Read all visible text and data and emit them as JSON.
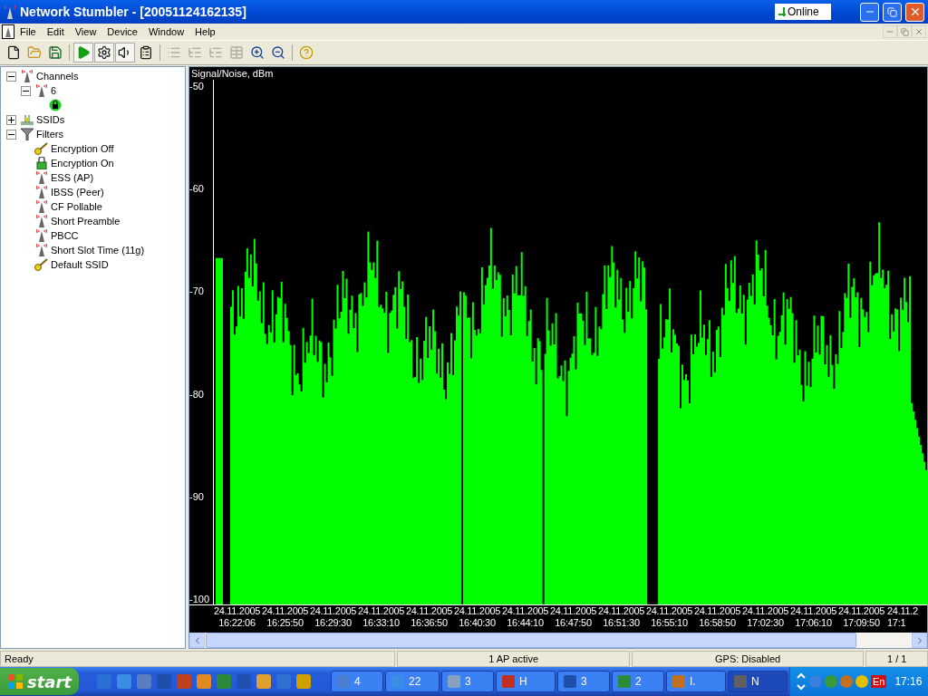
{
  "window": {
    "title": "Network Stumbler - [20051124162135]",
    "status_indicator": "Online"
  },
  "menu": [
    "File",
    "Edit",
    "View",
    "Device",
    "Window",
    "Help"
  ],
  "toolbar": [
    {
      "kind": "new",
      "pressed": false,
      "disabled": false
    },
    {
      "kind": "open",
      "pressed": false,
      "disabled": false
    },
    {
      "kind": "save",
      "pressed": false,
      "disabled": false
    },
    {
      "kind": "sep"
    },
    {
      "kind": "play",
      "pressed": true,
      "disabled": false
    },
    {
      "kind": "gear",
      "pressed": true,
      "disabled": false
    },
    {
      "kind": "speaker",
      "pressed": true,
      "disabled": false
    },
    {
      "kind": "props",
      "pressed": false,
      "disabled": false
    },
    {
      "kind": "sep"
    },
    {
      "kind": "list1",
      "pressed": false,
      "disabled": true
    },
    {
      "kind": "list2",
      "pressed": false,
      "disabled": true
    },
    {
      "kind": "list3",
      "pressed": false,
      "disabled": true
    },
    {
      "kind": "grid",
      "pressed": false,
      "disabled": true
    },
    {
      "kind": "zoomin",
      "pressed": false,
      "disabled": false
    },
    {
      "kind": "zoomout",
      "pressed": false,
      "disabled": false
    },
    {
      "kind": "sep"
    },
    {
      "kind": "help",
      "pressed": false,
      "disabled": false
    }
  ],
  "tree": [
    {
      "label": "Channels",
      "kind": "antenna",
      "expanded": true,
      "children": [
        {
          "label": "6",
          "kind": "antenna",
          "expanded": true,
          "children": [
            {
              "kind": "network"
            }
          ]
        }
      ]
    },
    {
      "label": "SSIDs",
      "kind": "ssid",
      "expanded": false
    },
    {
      "label": "Filters",
      "kind": "filter",
      "expanded": true,
      "children": [
        {
          "label": "Encryption Off",
          "kind": "key"
        },
        {
          "label": "Encryption On",
          "kind": "lock"
        },
        {
          "label": "ESS (AP)",
          "kind": "antenna"
        },
        {
          "label": "IBSS (Peer)",
          "kind": "antenna"
        },
        {
          "label": "CF Pollable",
          "kind": "antenna"
        },
        {
          "label": "Short Preamble",
          "kind": "antenna"
        },
        {
          "label": "PBCC",
          "kind": "antenna"
        },
        {
          "label": "Short Slot Time (11g)",
          "kind": "antenna"
        },
        {
          "label": "Default SSID",
          "kind": "key"
        }
      ]
    }
  ],
  "graph": {
    "ylabel": "Signal/Noise, dBm",
    "yticks": [
      "-50",
      "-60",
      "-70",
      "-80",
      "-90",
      "-100"
    ],
    "xlabels": [
      [
        "24.11.2005",
        "16:22:06"
      ],
      [
        "24.11.2005",
        "16:25:50"
      ],
      [
        "24.11.2005",
        "16:29:30"
      ],
      [
        "24.11.2005",
        "16:33:10"
      ],
      [
        "24.11.2005",
        "16:36:50"
      ],
      [
        "24.11.2005",
        "16:40:30"
      ],
      [
        "24.11.2005",
        "16:44:10"
      ],
      [
        "24.11.2005",
        "16:47:50"
      ],
      [
        "24.11.2005",
        "16:51:30"
      ],
      [
        "24.11.2005",
        "16:55:10"
      ],
      [
        "24.11.2005",
        "16:58:50"
      ],
      [
        "24.11.2005",
        "17:02:30"
      ],
      [
        "24.11.2005",
        "17:06:10"
      ],
      [
        "24.11.2005",
        "17:09:50"
      ],
      [
        "24.11.2",
        "17:1"
      ]
    ]
  },
  "status_bar": [
    "Ready",
    "1 AP active",
    "GPS: Disabled",
    "1 / 1"
  ],
  "taskbar": {
    "start": "start",
    "tasks": [
      {
        "label": "4",
        "color": "#4a7fd0",
        "selected": false
      },
      {
        "label": "22",
        "color": "#3a8ee6",
        "selected": false
      },
      {
        "label": "3",
        "color": "#8aa0c0",
        "selected": false
      },
      {
        "label": "H",
        "color": "#c03020",
        "selected": false
      },
      {
        "label": "3",
        "color": "#1f4fa8",
        "selected": false
      },
      {
        "label": "2",
        "color": "#2a8a3a",
        "selected": false
      },
      {
        "label": "I.",
        "color": "#c07020",
        "selected": false
      },
      {
        "label": "N",
        "color": "#606060",
        "selected": true
      }
    ],
    "tray_language": "En",
    "clock": "17:16"
  }
}
